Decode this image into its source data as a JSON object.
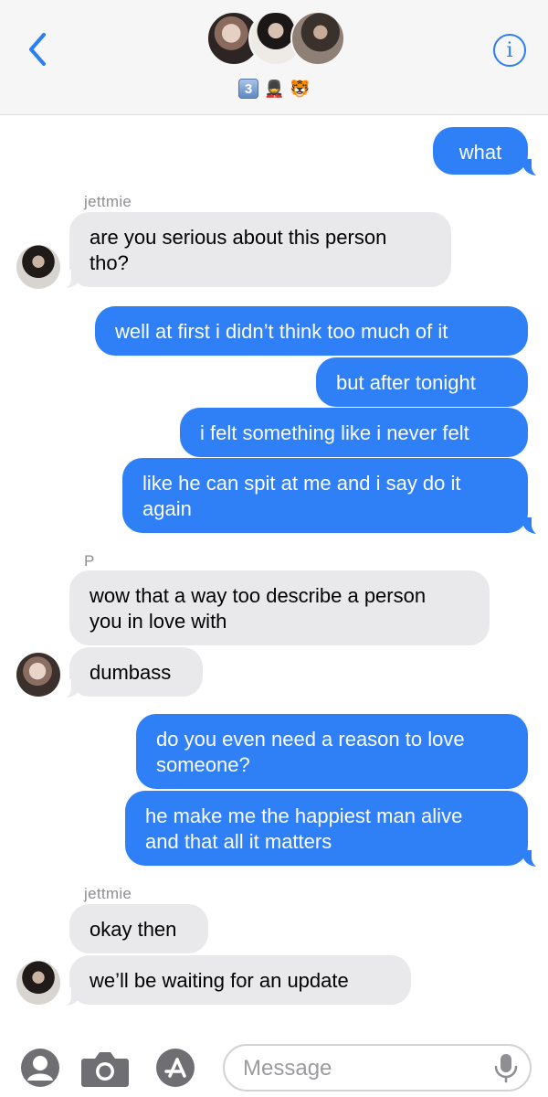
{
  "header": {
    "emojis": [
      "3",
      "💂",
      "🐯"
    ]
  },
  "messages": [
    {
      "text": "what"
    },
    {
      "sender": "jettmie"
    },
    {
      "text": "are you serious about this person"
    },
    {
      "text": "tho?"
    },
    {
      "text": "well at first i didn’t think too much of it"
    },
    {
      "text": "but after tonight"
    },
    {
      "text": "i felt something like i never felt"
    },
    {
      "text": "like he can spit at me and i say do it"
    },
    {
      "text": "again"
    },
    {
      "sender": "P"
    },
    {
      "text": "wow that a way too describe a person"
    },
    {
      "text": "you in love with"
    },
    {
      "text": "dumbass"
    },
    {
      "text": "do you even need a reason to love"
    },
    {
      "text": "someone?"
    },
    {
      "text": "he make me the happiest man alive"
    },
    {
      "text": "and that all it matters"
    },
    {
      "sender": "jettmie"
    },
    {
      "text": "okay then"
    },
    {
      "text": "we’ll be waiting for an update"
    }
  ],
  "composer": {
    "placeholder": "Message"
  },
  "colors": {
    "accent": "#2f7ff7",
    "incoming_bubble": "#e9e9eb",
    "icon_gray": "#6e6e73"
  }
}
